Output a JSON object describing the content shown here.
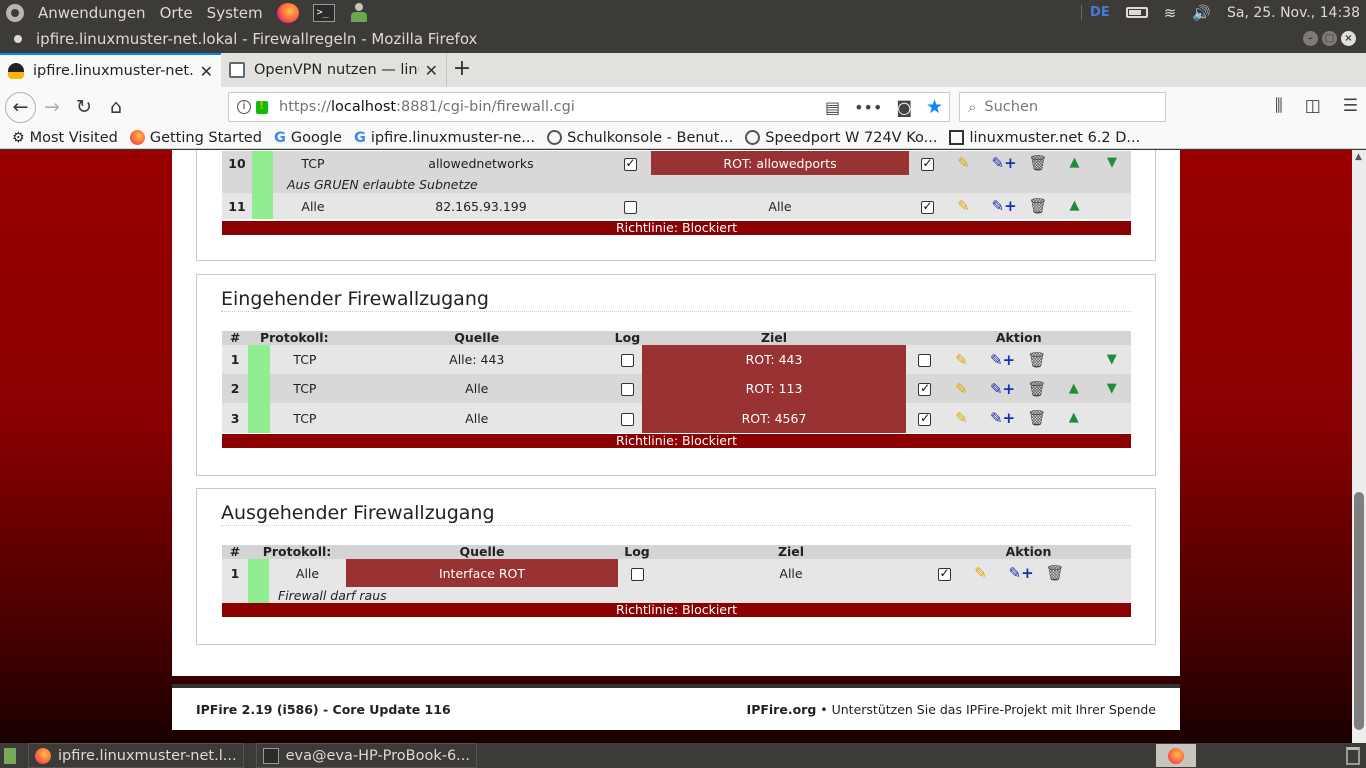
{
  "top_panel": {
    "menus": [
      "Anwendungen",
      "Orte",
      "System"
    ],
    "keyboard": "DE",
    "datetime": "Sa, 25. Nov., 14:38"
  },
  "window": {
    "title": "ipfire.linuxmuster-net.lokal - Firewallregeln - Mozilla Firefox"
  },
  "tabs": [
    {
      "label": "ipfire.linuxmuster-net.lokal - Firewallregeln",
      "active": true
    },
    {
      "label": "OpenVPN nutzen — linuxmuster.net",
      "active": false
    }
  ],
  "urlbar": {
    "prefix": "https://",
    "host": "localhost",
    "path": ":8881/cgi-bin/firewall.cgi"
  },
  "search": {
    "placeholder": "Suchen"
  },
  "bookmarks": [
    {
      "label": "Most Visited",
      "icon": "gear-icon"
    },
    {
      "label": "Getting Started",
      "icon": "firefox-icon"
    },
    {
      "label": "Google",
      "icon": "google-icon"
    },
    {
      "label": "ipfire.linuxmuster-ne...",
      "icon": "google-icon"
    },
    {
      "label": "Schulkonsole - Benut...",
      "icon": "globe-icon"
    },
    {
      "label": "Speedport W 724V Ko...",
      "icon": "globe-icon"
    },
    {
      "label": "linuxmuster.net 6.2 D...",
      "icon": "book-icon"
    }
  ],
  "page": {
    "top_table": {
      "rows": [
        {
          "num": "10",
          "protocol": "TCP",
          "source": "allowednetworks",
          "log": true,
          "target": "ROT: allowedports",
          "target_red": true,
          "active": true,
          "up": true,
          "down": true,
          "note": "Aus GRUEN erlaubte Subnetze"
        },
        {
          "num": "11",
          "protocol": "Alle",
          "source": "82.165.93.199",
          "log": false,
          "target": "Alle",
          "target_red": false,
          "active": true,
          "up": true,
          "down": false
        }
      ],
      "policy": "Richtlinie: Blockiert"
    },
    "incoming": {
      "title": "Eingehender Firewallzugang",
      "headers": [
        "#",
        "Protokoll:",
        "Quelle",
        "Log",
        "Ziel",
        "Aktion"
      ],
      "rows": [
        {
          "num": "1",
          "protocol": "TCP",
          "source": "Alle: 443",
          "log": false,
          "target": "ROT: 443",
          "active": false,
          "up": false,
          "down": true
        },
        {
          "num": "2",
          "protocol": "TCP",
          "source": "Alle",
          "log": false,
          "target": "ROT: 113",
          "active": true,
          "up": true,
          "down": true
        },
        {
          "num": "3",
          "protocol": "TCP",
          "source": "Alle",
          "log": false,
          "target": "ROT: 4567",
          "active": true,
          "up": true,
          "down": false
        }
      ],
      "policy": "Richtlinie: Blockiert"
    },
    "outgoing": {
      "title": "Ausgehender Firewallzugang",
      "headers": [
        "#",
        "Protokoll:",
        "Quelle",
        "Log",
        "Ziel",
        "Aktion"
      ],
      "rows": [
        {
          "num": "1",
          "protocol": "Alle",
          "source": "Interface ROT",
          "log": false,
          "target": "Alle",
          "active": true,
          "note": "Firewall darf raus"
        }
      ],
      "policy": "Richtlinie: Blockiert"
    },
    "footer": {
      "version": "IPFire 2.19 (i586) - Core Update 116",
      "org": "IPFire.org",
      "donate": " • Unterstützen Sie das IPFire-Projekt mit Ihrer Spende"
    }
  },
  "taskbar": {
    "tasks": [
      "ipfire.linuxmuster-net.l...",
      "eva@eva-HP-ProBook-6..."
    ]
  },
  "colors": {
    "policy_bar": "#8b0000",
    "red_target": "#993333",
    "green_marker": "#90ee90",
    "background_red": "#990000"
  }
}
